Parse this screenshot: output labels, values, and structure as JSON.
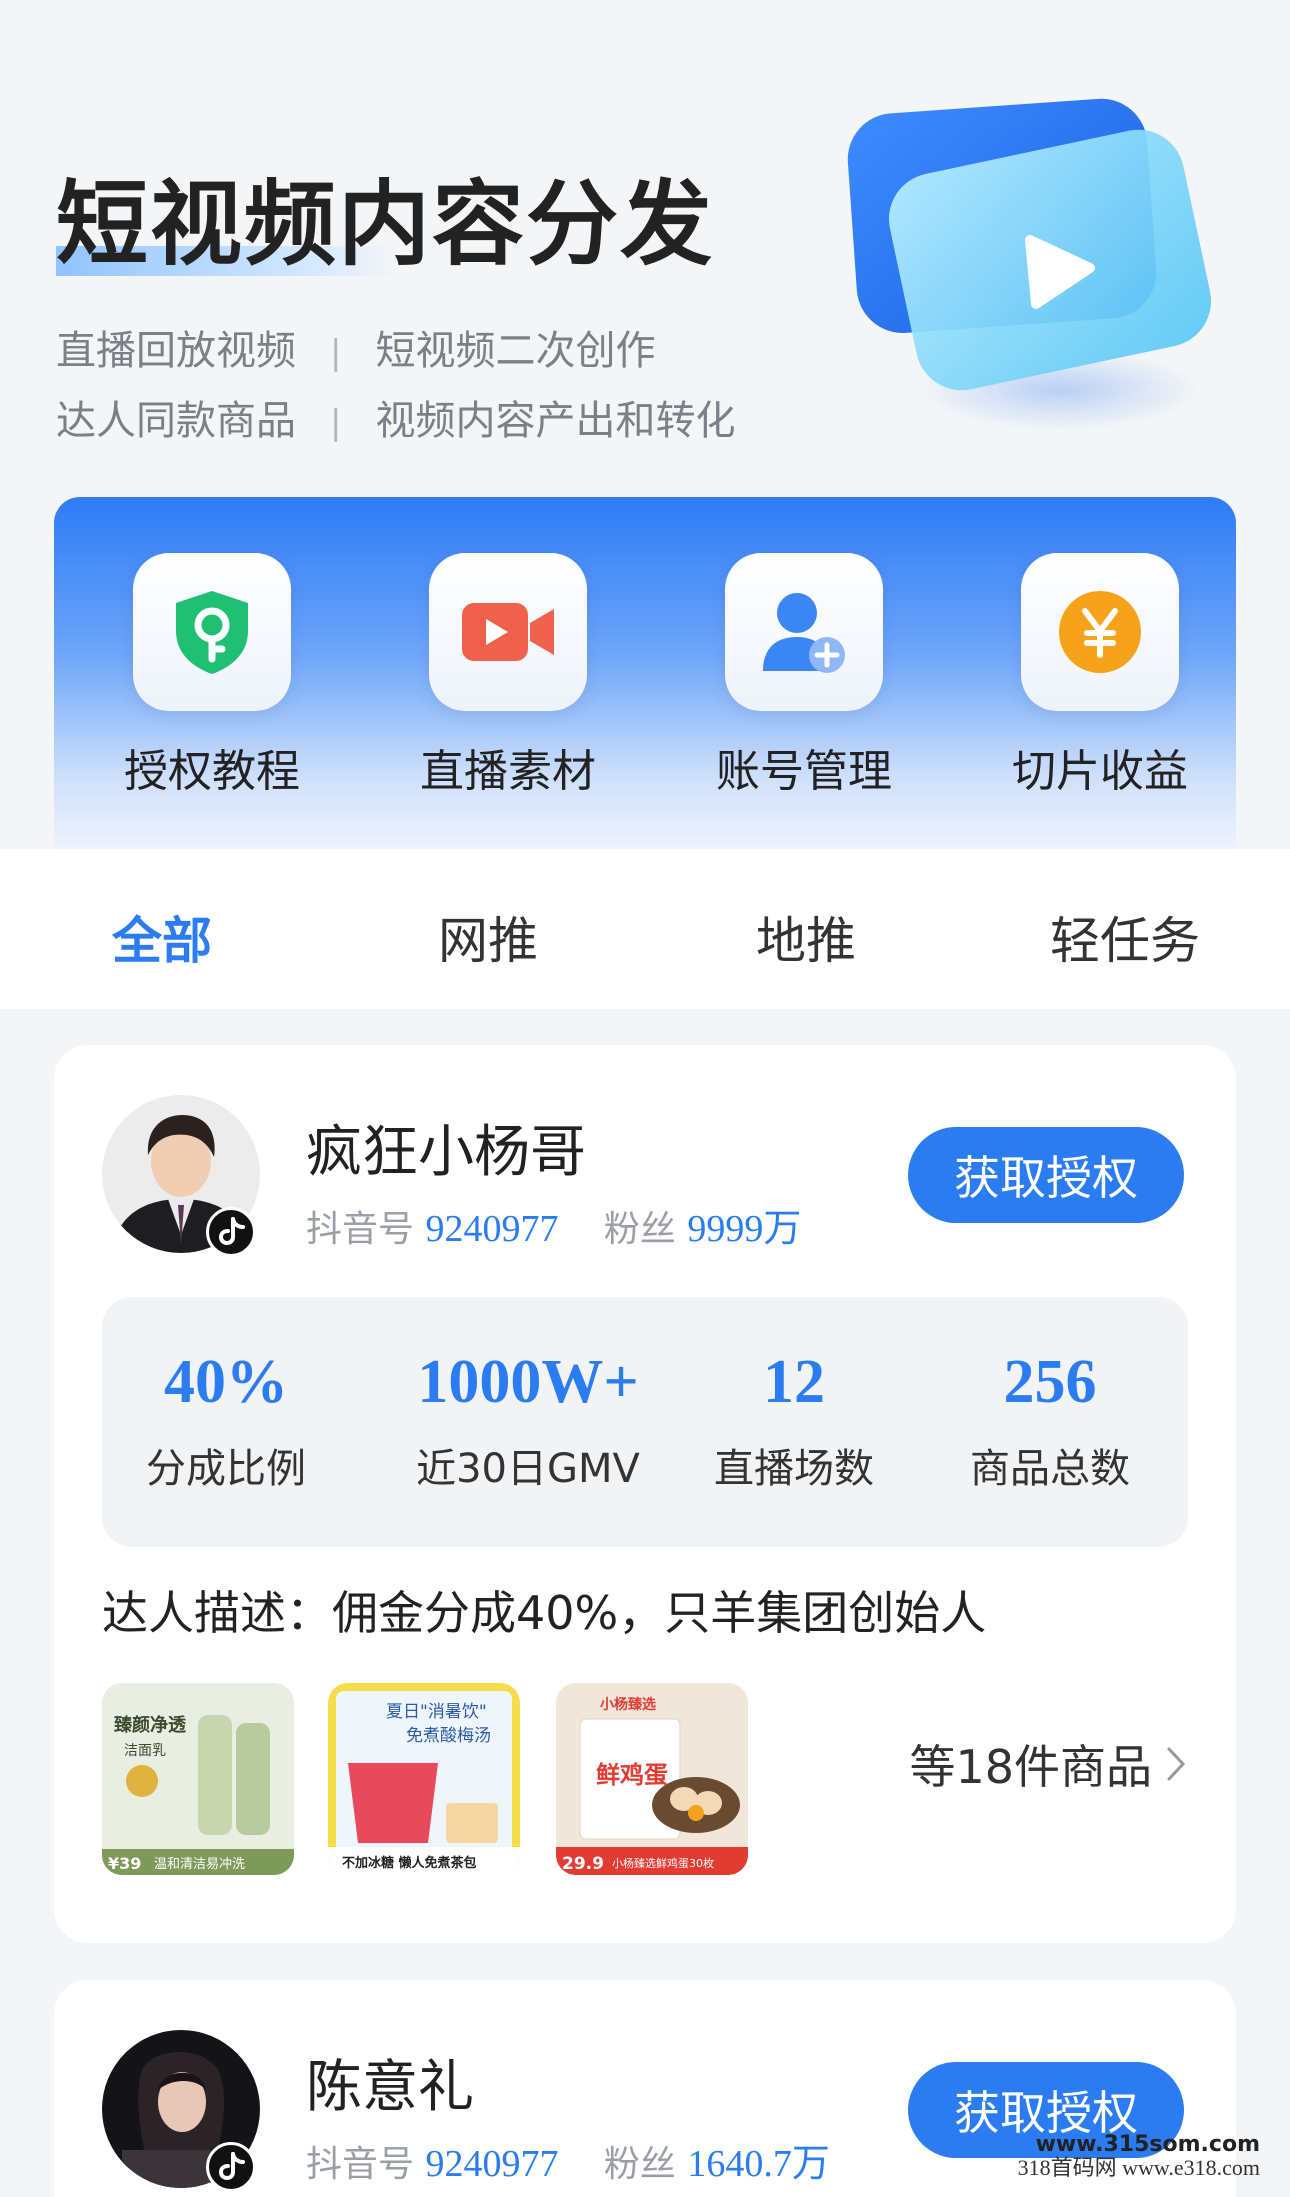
{
  "hero": {
    "title": "短视频内容分发",
    "features_row1": [
      "直播回放视频",
      "短视频二次创作"
    ],
    "features_row2": [
      "达人同款商品",
      "视频内容产出和转化"
    ],
    "separator": "|"
  },
  "quick_actions": [
    {
      "label": "授权教程",
      "icon": "shield-key-icon",
      "color": "#1fbf74"
    },
    {
      "label": "直播素材",
      "icon": "video-camera-icon",
      "color": "#f0614d"
    },
    {
      "label": "账号管理",
      "icon": "add-user-icon",
      "color": "#3b86f5"
    },
    {
      "label": "切片收益",
      "icon": "yuan-coin-icon",
      "color": "#f7a21b"
    }
  ],
  "tabs": [
    {
      "label": "全部",
      "active": true
    },
    {
      "label": "网推",
      "active": false
    },
    {
      "label": "地推",
      "active": false
    },
    {
      "label": "轻任务",
      "active": false
    }
  ],
  "creators": [
    {
      "name": "疯狂小杨哥",
      "douyin_label": "抖音号",
      "douyin_id": "9240977",
      "fans_label": "粉丝",
      "fans": "9999万",
      "button": "获取授权",
      "stats": [
        {
          "value": "40%",
          "label": "分成比例"
        },
        {
          "value": "1000W+",
          "label": "近30日GMV"
        },
        {
          "value": "12",
          "label": "直播场数"
        },
        {
          "value": "256",
          "label": "商品总数"
        }
      ],
      "description": "达人描述：佣金分成40%，只羊集团创始人",
      "products": [
        {
          "title": "臻颜净透",
          "subtitle": "洁面乳",
          "price": "¥39",
          "caption": "温和清洁易冲洗"
        },
        {
          "title": "夏日\"消暑饮\"",
          "subtitle": "免煮酸梅汤",
          "price": "",
          "caption": "不加冰糖 懒人免煮茶包"
        },
        {
          "title": "鲜鸡蛋",
          "subtitle": "小杨臻选",
          "price": "29.9",
          "caption": "小杨臻选鲜鸡蛋30枚"
        }
      ],
      "more": "等18件商品"
    },
    {
      "name": "陈意礼",
      "douyin_label": "抖音号",
      "douyin_id": "9240977",
      "fans_label": "粉丝",
      "fans": "1640.7万",
      "button": "获取授权"
    }
  ],
  "watermark": {
    "line1": "www.315som.com",
    "line2": "318首码网  www.e318.com"
  },
  "colors": {
    "accent": "#2a7cf0",
    "panel_top": "#2e7bf6",
    "background": "#f4f5f6"
  }
}
